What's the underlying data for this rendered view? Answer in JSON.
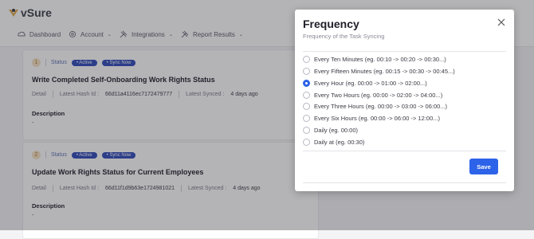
{
  "app": {
    "logo_text": "vSure"
  },
  "nav": [
    {
      "label": "Dashboard",
      "icon": "cloud-icon"
    },
    {
      "label": "Account",
      "icon": "gear-icon"
    },
    {
      "label": "Integrations",
      "icon": "tools-icon"
    },
    {
      "label": "Report Results",
      "icon": "tools-icon"
    }
  ],
  "cards": [
    {
      "num": "1",
      "status_label": "Status",
      "badge_active": "• Active",
      "badge_sync": "• Sync Now",
      "title": "Write Completed Self-Onboarding Work Rights Status",
      "detail_label": "Detail",
      "hash_label": "Latest Hash Id :",
      "hash_value": "66d11a4116ec7172479777",
      "synced_label": "Latest Synced :",
      "synced_value": "4 days ago",
      "description_label": "Description",
      "description_value": "-"
    },
    {
      "num": "2",
      "status_label": "Status",
      "badge_active": "• Active",
      "badge_sync": "• Sync Now",
      "title": "Update Work Rights Status for Current Employees",
      "detail_label": "Detail",
      "hash_label": "Latest Hash Id :",
      "hash_value": "66d11f1d9b63e1724981021",
      "synced_label": "Latest Synced :",
      "synced_value": "4 days ago",
      "description_label": "Description",
      "description_value": "-"
    }
  ],
  "modal": {
    "title": "Frequency",
    "subtitle": "Frequency of the Task Syncing",
    "options": [
      "Every Ten Minutes (eg. 00:10 -> 00:20 -> 00:30...)",
      "Every Fifteen Minutes (eg. 00:15 -> 00:30 -> 00:45...)",
      "Every Hour (eg. 00:00 -> 01:00 -> 02:00...)",
      "Every Two Hours (eg. 00:00 -> 02:00 -> 04:00...)",
      "Every Three Hours (eg. 00:00 -> 03:00 -> 06:00...)",
      "Every Six Hours (eg. 00:00 -> 06:00 -> 12:00...)",
      "Daily (eg. 00:00)",
      "Daily at (eg. 00:30)"
    ],
    "selected_index": 2,
    "save_label": "Save",
    "accent_color": "#2d63e8"
  }
}
